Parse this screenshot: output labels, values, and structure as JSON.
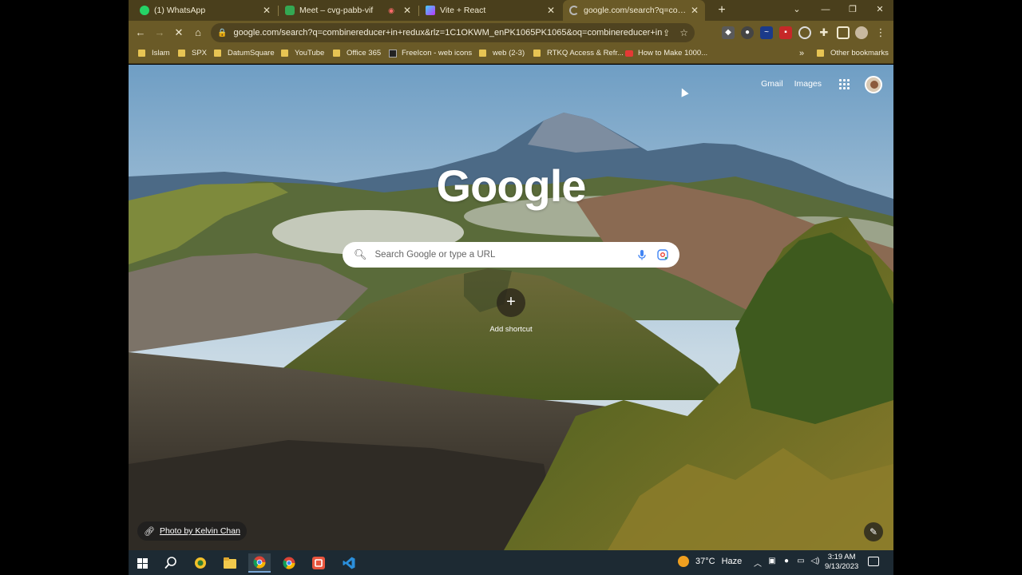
{
  "tabs": [
    {
      "label": "(1) WhatsApp",
      "icon": "whatsapp-icon",
      "color": "#25d366"
    },
    {
      "label": "Meet – cvg-pabb-vif",
      "icon": "meet-icon",
      "color": "#34a853"
    },
    {
      "label": "Vite + React",
      "icon": "vite-icon",
      "color": "#a57aff"
    },
    {
      "label": "google.com/search?q=combinereducer",
      "icon": "loading-icon",
      "color": "#b9b9b9"
    }
  ],
  "toolbar": {
    "url": "google.com/search?q=combinereducer+in+redux&rlz=1C1OKWM_enPK1065PK1065&oq=combinereducer+in+redu..."
  },
  "bookmarks": [
    {
      "label": "Islam",
      "type": "folder"
    },
    {
      "label": "SPX",
      "type": "folder"
    },
    {
      "label": "DatumSquare",
      "type": "folder"
    },
    {
      "label": "YouTube",
      "type": "folder"
    },
    {
      "label": "Office 365",
      "type": "folder"
    },
    {
      "label": "FreeIcon - web icons",
      "type": "site"
    },
    {
      "label": "web (2-3)",
      "type": "folder"
    },
    {
      "label": "RTKQ Access & Refr...",
      "type": "folder"
    },
    {
      "label": "How to Make 1000...",
      "type": "youtube"
    }
  ],
  "bookmarks_more": "»",
  "other_bookmarks": "Other bookmarks",
  "page": {
    "gmail": "Gmail",
    "images": "Images",
    "logo": "Google",
    "search_placeholder": "Search Google or type a URL",
    "add_shortcut": "Add shortcut",
    "photo_credit": "Photo by Kelvin Chan"
  },
  "taskbar": {
    "weather_temp": "37°C",
    "weather_desc": "Haze",
    "time": "3:19 AM",
    "date": "9/13/2023"
  },
  "colors": {
    "tab_strip": "#4a3f1c",
    "toolbar": "#6a5a27",
    "taskbar": "#1d2a33"
  }
}
